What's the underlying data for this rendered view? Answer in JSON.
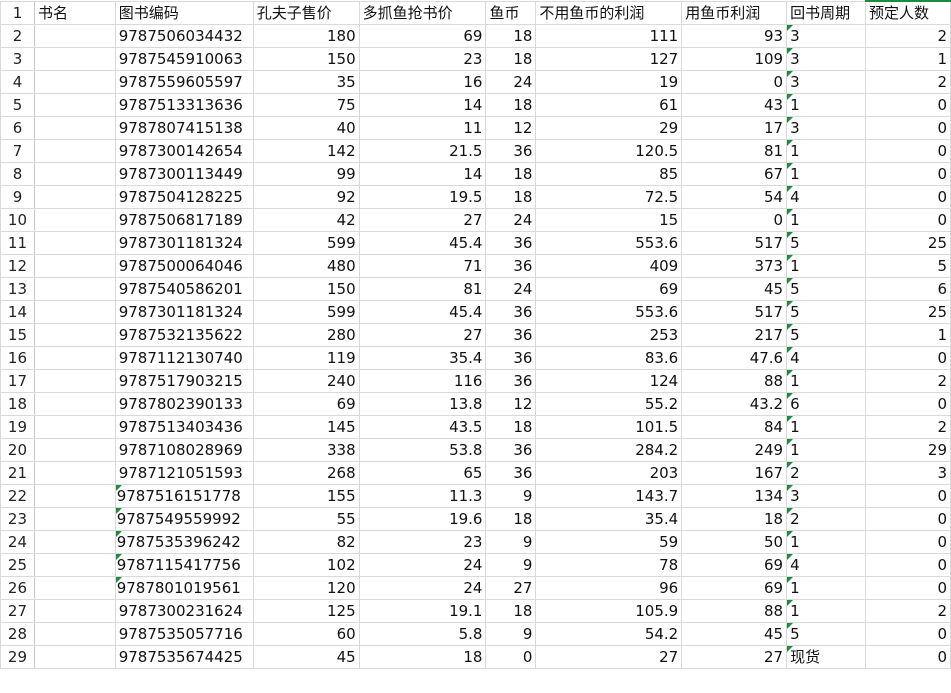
{
  "header": {
    "row_num": "1",
    "cols": [
      "书名",
      "图书编码",
      "孔夫子售价",
      "多抓鱼抢书价",
      "鱼币",
      "不用鱼币的利润",
      "用鱼币利润",
      "回书周期",
      "预定人数"
    ]
  },
  "rows": [
    {
      "n": "2",
      "isbn": "9787506034432",
      "price": "180",
      "qiang": "69",
      "yubi": "18",
      "p1": "111",
      "p2": "93",
      "cycle": "3",
      "book": "2"
    },
    {
      "n": "3",
      "isbn": "9787545910063",
      "price": "150",
      "qiang": "23",
      "yubi": "18",
      "p1": "127",
      "p2": "109",
      "cycle": "3",
      "book": "1"
    },
    {
      "n": "4",
      "isbn": "9787559605597",
      "price": "35",
      "qiang": "16",
      "yubi": "24",
      "p1": "19",
      "p2": "0",
      "cycle": "3",
      "book": "2"
    },
    {
      "n": "5",
      "isbn": "9787513313636",
      "price": "75",
      "qiang": "14",
      "yubi": "18",
      "p1": "61",
      "p2": "43",
      "cycle": "1",
      "book": "0"
    },
    {
      "n": "6",
      "isbn": "9787807415138",
      "price": "40",
      "qiang": "11",
      "yubi": "12",
      "p1": "29",
      "p2": "17",
      "cycle": "3",
      "book": "0"
    },
    {
      "n": "7",
      "isbn": "9787300142654",
      "price": "142",
      "qiang": "21.5",
      "yubi": "36",
      "p1": "120.5",
      "p2": "81",
      "cycle": "1",
      "book": "0"
    },
    {
      "n": "8",
      "isbn": "9787300113449",
      "price": "99",
      "qiang": "14",
      "yubi": "18",
      "p1": "85",
      "p2": "67",
      "cycle": "1",
      "book": "0"
    },
    {
      "n": "9",
      "isbn": "9787504128225",
      "price": "92",
      "qiang": "19.5",
      "yubi": "18",
      "p1": "72.5",
      "p2": "54",
      "cycle": "4",
      "book": "0"
    },
    {
      "n": "10",
      "isbn": "9787506817189",
      "price": "42",
      "qiang": "27",
      "yubi": "24",
      "p1": "15",
      "p2": "0",
      "cycle": "1",
      "book": "0"
    },
    {
      "n": "11",
      "isbn": "9787301181324",
      "price": "599",
      "qiang": "45.4",
      "yubi": "36",
      "p1": "553.6",
      "p2": "517",
      "cycle": "5",
      "book": "25"
    },
    {
      "n": "12",
      "isbn": "9787500064046",
      "price": "480",
      "qiang": "71",
      "yubi": "36",
      "p1": "409",
      "p2": "373",
      "cycle": "1",
      "book": "5"
    },
    {
      "n": "13",
      "isbn": "9787540586201",
      "price": "150",
      "qiang": "81",
      "yubi": "24",
      "p1": "69",
      "p2": "45",
      "cycle": "5",
      "book": "6"
    },
    {
      "n": "14",
      "isbn": "9787301181324",
      "price": "599",
      "qiang": "45.4",
      "yubi": "36",
      "p1": "553.6",
      "p2": "517",
      "cycle": "5",
      "book": "25"
    },
    {
      "n": "15",
      "isbn": "9787532135622",
      "price": "280",
      "qiang": "27",
      "yubi": "36",
      "p1": "253",
      "p2": "217",
      "cycle": "5",
      "book": "1"
    },
    {
      "n": "16",
      "isbn": "9787112130740",
      "price": "119",
      "qiang": "35.4",
      "yubi": "36",
      "p1": "83.6",
      "p2": "47.6",
      "cycle": "4",
      "book": "0"
    },
    {
      "n": "17",
      "isbn": "9787517903215",
      "price": "240",
      "qiang": "116",
      "yubi": "36",
      "p1": "124",
      "p2": "88",
      "cycle": "1",
      "book": "2"
    },
    {
      "n": "18",
      "isbn": "9787802390133",
      "price": "69",
      "qiang": "13.8",
      "yubi": "12",
      "p1": "55.2",
      "p2": "43.2",
      "cycle": "6",
      "book": "0"
    },
    {
      "n": "19",
      "isbn": "9787513403436",
      "price": "145",
      "qiang": "43.5",
      "yubi": "18",
      "p1": "101.5",
      "p2": "84",
      "cycle": "1",
      "book": "2"
    },
    {
      "n": "20",
      "isbn": "9787108028969",
      "price": "338",
      "qiang": "53.8",
      "yubi": "36",
      "p1": "284.2",
      "p2": "249",
      "cycle": "1",
      "book": "29"
    },
    {
      "n": "21",
      "isbn": "9787121051593",
      "price": "268",
      "qiang": "65",
      "yubi": "36",
      "p1": "203",
      "p2": "167",
      "cycle": "2",
      "book": "3"
    },
    {
      "n": "22",
      "isbn": "9787516151778",
      "price": "155",
      "qiang": "11.3",
      "yubi": "9",
      "p1": "143.7",
      "p2": "134",
      "cycle": "3",
      "book": "0",
      "text": true
    },
    {
      "n": "23",
      "isbn": "9787549559992",
      "price": "55",
      "qiang": "19.6",
      "yubi": "18",
      "p1": "35.4",
      "p2": "18",
      "cycle": "2",
      "book": "0",
      "text": true
    },
    {
      "n": "24",
      "isbn": "9787535396242",
      "price": "82",
      "qiang": "23",
      "yubi": "9",
      "p1": "59",
      "p2": "50",
      "cycle": "1",
      "book": "0",
      "text": true
    },
    {
      "n": "25",
      "isbn": "9787115417756",
      "price": "102",
      "qiang": "24",
      "yubi": "9",
      "p1": "78",
      "p2": "69",
      "cycle": "4",
      "book": "0",
      "text": true
    },
    {
      "n": "26",
      "isbn": "9787801019561",
      "price": "120",
      "qiang": "24",
      "yubi": "27",
      "p1": "96",
      "p2": "69",
      "cycle": "1",
      "book": "0",
      "text": true
    },
    {
      "n": "27",
      "isbn": "9787300231624",
      "price": "125",
      "qiang": "19.1",
      "yubi": "18",
      "p1": "105.9",
      "p2": "88",
      "cycle": "1",
      "book": "2"
    },
    {
      "n": "28",
      "isbn": "9787535057716",
      "price": "60",
      "qiang": "5.8",
      "yubi": "9",
      "p1": "54.2",
      "p2": "45",
      "cycle": "5",
      "book": "0"
    },
    {
      "n": "29",
      "isbn": "9787535674425",
      "price": "45",
      "qiang": "18",
      "yubi": "0",
      "p1": "27",
      "p2": "27",
      "cycle": "现货",
      "book": "0"
    }
  ],
  "colors": {
    "gridline": "#d9d9d9",
    "text_marker": "#1e8b3a"
  }
}
